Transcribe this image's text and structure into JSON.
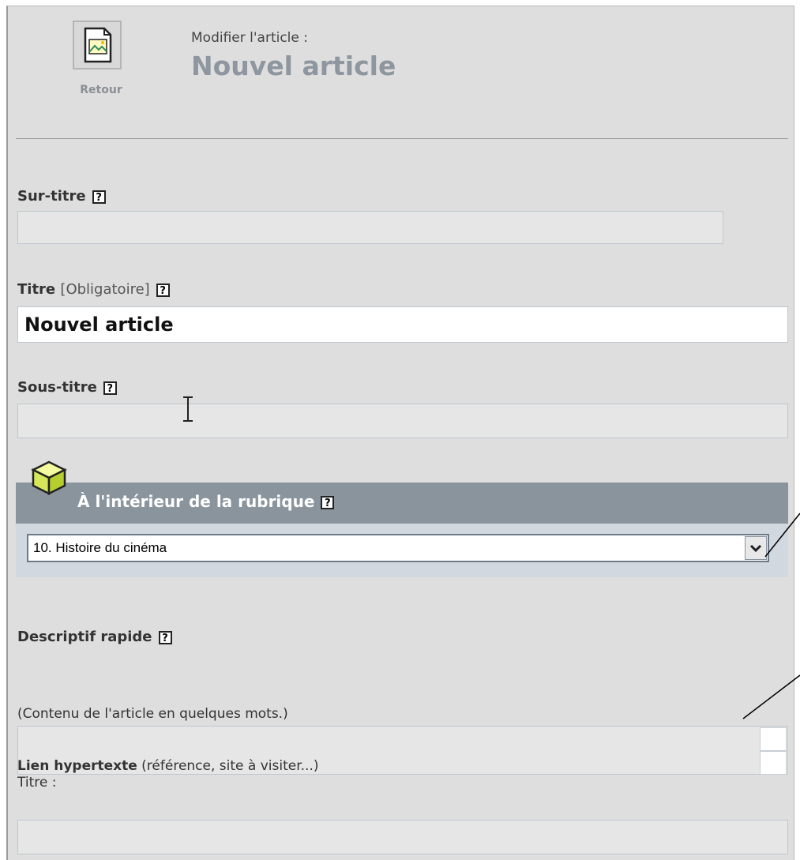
{
  "header": {
    "back_label": "Retour",
    "subtitle": "Modifier l'article :",
    "title": "Nouvel article"
  },
  "fields": {
    "surtitre": {
      "label": "Sur-titre",
      "value": ""
    },
    "titre": {
      "label": "Titre",
      "required_note": "[Obligatoire]",
      "value": "Nouvel article"
    },
    "soustitre": {
      "label": "Sous-titre",
      "value": ""
    },
    "descriptif": {
      "label": "Descriptif rapide",
      "hint": "(Contenu de l'article en quelques mots.)",
      "value": ""
    },
    "lien": {
      "label": "Lien hypertexte",
      "note": "(référence, site à visiter...)",
      "title_label": "Titre :",
      "value": ""
    }
  },
  "rubrique": {
    "heading": "À l'intérieur de la rubrique",
    "selected": "10. Histoire du cinéma"
  },
  "help_glyph": "?",
  "colors": {
    "panel_bg": "#dedede",
    "rubrique_header": "#8a949d",
    "rubrique_body": "#d1d8df",
    "title_grey": "#8e969f"
  }
}
